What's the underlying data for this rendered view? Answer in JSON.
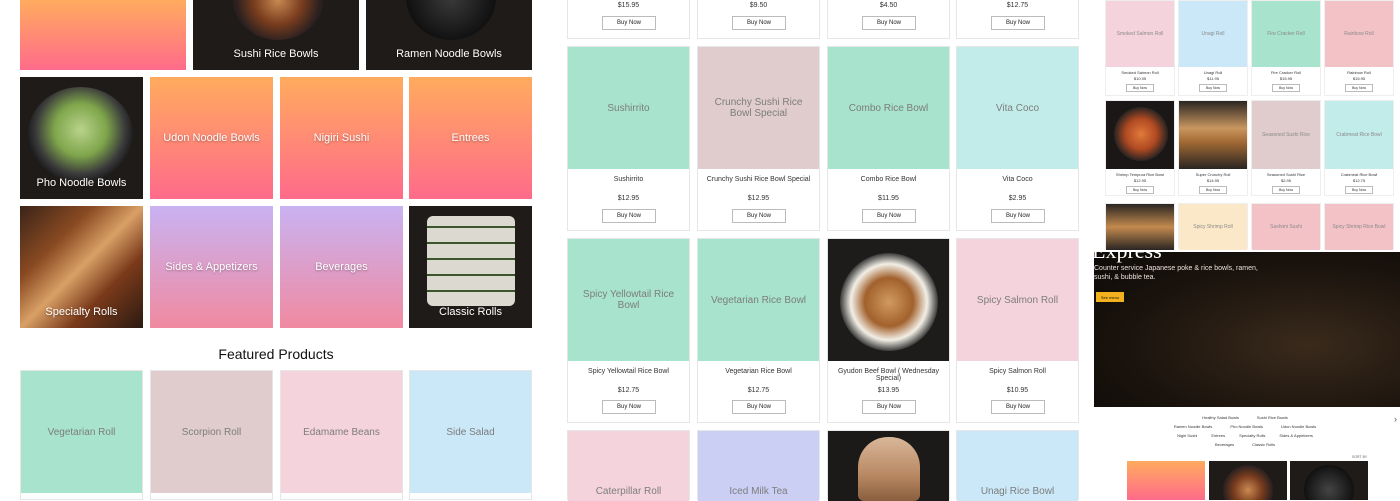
{
  "left": {
    "categories_row1": [
      "Sushi Rice Bowls",
      "Ramen Noodle Bowls"
    ],
    "categories_row2": [
      "Pho Noodle Bowls",
      "Udon Noodle Bowls",
      "Nigiri Sushi",
      "Entrees"
    ],
    "categories_row3": [
      "Specialty Rolls",
      "Sides & Appetizers",
      "Beverages",
      "Classic Rolls"
    ],
    "featured_title": "Featured Products",
    "featured": [
      "Vegetarian Roll",
      "Scorpion Roll",
      "Edamame Beans",
      "Side Salad"
    ]
  },
  "middle": {
    "top_prices": [
      "$15.95",
      "$9.50",
      "$4.50",
      "$12.75"
    ],
    "buy_label": "Buy Now",
    "row2": [
      {
        "placeholder": "Sushirrito",
        "name": "Sushirrito",
        "price": "$12.95"
      },
      {
        "placeholder": "Crunchy Sushi Rice Bowl Special",
        "name": "Crunchy Sushi Rice Bowl Special",
        "price": "$12.95"
      },
      {
        "placeholder": "Combo Rice Bowl",
        "name": "Combo Rice Bowl",
        "price": "$11.95"
      },
      {
        "placeholder": "Vita Coco",
        "name": "Vita Coco",
        "price": "$2.95"
      }
    ],
    "row3": [
      {
        "placeholder": "Spicy Yellowtail Rice Bowl",
        "name": "Spicy Yellowtail Rice Bowl",
        "price": "$12.75"
      },
      {
        "placeholder": "Vegetarian Rice Bowl",
        "name": "Vegetarian Rice Bowl",
        "price": "$12.75"
      },
      {
        "placeholder": "",
        "name": "Gyudon Beef Bowl ( Wednesday Special)",
        "price": "$13.95"
      },
      {
        "placeholder": "Spicy Salmon Roll",
        "name": "Spicy Salmon Roll",
        "price": "$10.95"
      }
    ],
    "row4": [
      "Caterpillar Roll",
      "Iced Milk Tea",
      "",
      "Unagi Rice Bowl"
    ]
  },
  "right": {
    "row1": [
      {
        "placeholder": "Smoked Salmon Roll",
        "name": "Smoked Salmon Roll",
        "price": "$10.95"
      },
      {
        "placeholder": "Unagi Roll",
        "name": "Unagi Roll",
        "price": "$11.95"
      },
      {
        "placeholder": "Fire Cracker Roll",
        "name": "Fire Cracker Roll",
        "price": "$15.95"
      },
      {
        "placeholder": "Rainbow Roll",
        "name": "Rainbow Roll",
        "price": "$15.95"
      }
    ],
    "row2": [
      {
        "placeholder": "",
        "name": "Shrimp Tempura Rice Bowl",
        "price": "$12.95"
      },
      {
        "placeholder": "",
        "name": "Super Crunchy Roll",
        "price": "$14.95"
      },
      {
        "placeholder": "Seasoned Sushi Rice",
        "name": "Seasoned Sushi Rice",
        "price": "$2.95"
      },
      {
        "placeholder": "Crabmeat Rice Bowl",
        "name": "Crabmeat Rice Bowl",
        "price": "$12.75"
      }
    ],
    "row3": [
      "",
      "Spicy Shrimp Roll",
      "Sashimi Sushi",
      "Spicy Shrimp Rice Bowl"
    ],
    "buy_label": "Buy Now",
    "hero_title": "Express",
    "hero_text_1": "Counter service Japanese poke & rice bowls, ramen,",
    "hero_text_2": "sushi, & bubble tea.",
    "hero_button": "See menu",
    "menu_links": [
      [
        "Healthy Salad Bowls",
        "Sushi Rice Bowls"
      ],
      [
        "Ramen Noodle Bowls",
        "Pho Noodle Bowls",
        "Udon Noodle Bowls"
      ],
      [
        "Nigiri Sushi",
        "Entrees",
        "Specialty Rolls",
        "Sides & Appetizers"
      ],
      [
        "Beverages",
        "Classic Rolls"
      ]
    ],
    "sort_label": "SORT BY"
  }
}
